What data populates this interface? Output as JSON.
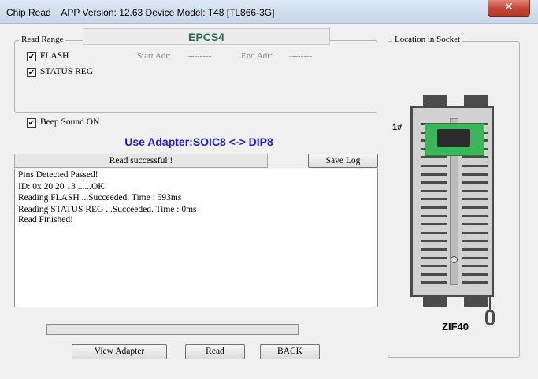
{
  "window": {
    "title": "Chip Read    APP Version: 12.63 Device Model: T48 [TL866-3G]",
    "close_glyph": "✕"
  },
  "read_range": {
    "legend": "Read Range",
    "chip_name": "EPCS4",
    "options": [
      {
        "label": "FLASH",
        "checked": true
      },
      {
        "label": "STATUS REG",
        "checked": true
      }
    ],
    "start_adr_label": "Start Adr:",
    "start_adr_value": "--------",
    "end_adr_label": "End Adr:",
    "end_adr_value": "--------"
  },
  "beep": {
    "label": "Beep Sound ON",
    "checked": true
  },
  "adapter_text": "Use Adapter:SOIC8 <-> DIP8",
  "status_text": "Read successful !",
  "save_log_label": "Save Log",
  "log_lines": [
    "Pins Detected Passed!",
    "ID: 0x 20 20 13 ......OK!",
    "Reading FLASH ...Succeeded. Time : 593ms",
    "Reading STATUS REG ...Succeeded. Time : 0ms",
    "Read Finished!"
  ],
  "progress": {
    "percent": 0
  },
  "buttons": {
    "view_adapter": "View Adapter",
    "read": "Read",
    "back": "BACK"
  },
  "socket": {
    "legend": "Location in Socket",
    "pin1_label": "1#",
    "model": "ZIF40",
    "chip_color": "#3cb55a"
  },
  "check_glyph": "✔"
}
